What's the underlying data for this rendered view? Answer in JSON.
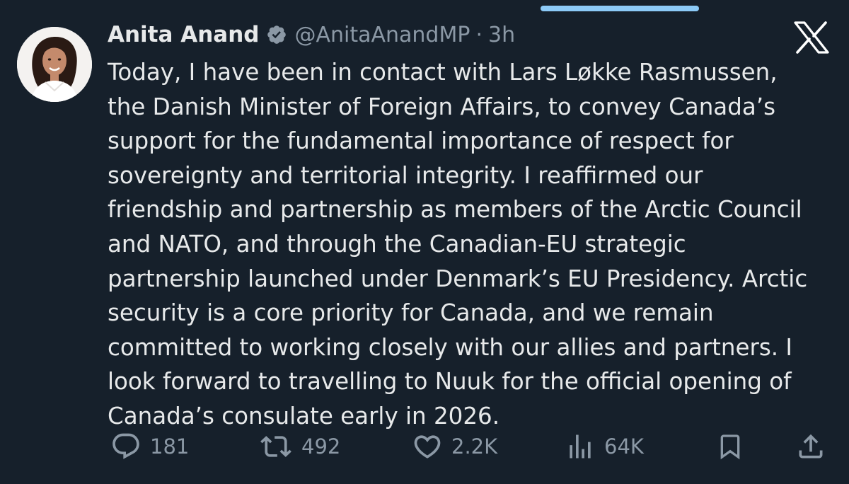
{
  "tweet": {
    "author_name": "Anita Anand",
    "handle": "@AnitaAnandMP",
    "separator": "·",
    "time": "3h",
    "lines": [
      "Today, I have been in contact with Lars Løkke Rasmussen,",
      "the Danish Minister of Foreign Affairs, to convey Canada’s",
      "support for the fundamental importance of respect for",
      "sovereignty and territorial integrity. I reaffirmed our",
      "friendship and partnership as members of the Arctic Council",
      "and NATO, and through the Canadian-EU strategic",
      "partnership launched under Denmark’s EU Presidency. Arctic",
      "security is a core priority for Canada, and we remain",
      "committed to working closely with our allies and partners. I",
      "look forward to travelling to Nuuk for the official opening of",
      "Canada’s consulate early in 2026."
    ]
  },
  "actions": {
    "replies": "181",
    "reposts": "492",
    "likes": "2.2K",
    "views": "64K"
  },
  "icons": {
    "verified": "verified-badge-icon",
    "logo": "x-logo-icon",
    "reply": "reply-icon",
    "repost": "repost-icon",
    "like": "heart-icon",
    "views": "views-chart-icon",
    "bookmark": "bookmark-icon",
    "share": "share-icon"
  },
  "colors": {
    "background": "#16202b",
    "text": "#e7e9ea",
    "muted": "#8b98a5",
    "indicator": "#8ccaf7"
  }
}
